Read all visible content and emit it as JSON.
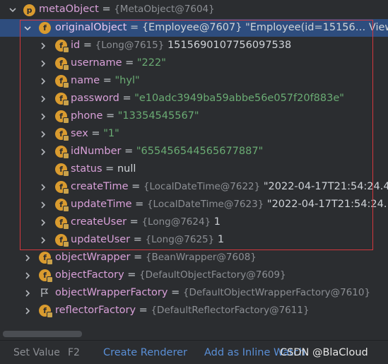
{
  "rows": [
    {
      "name": "metaObject",
      "badge": "p",
      "value": "{MetaObject@7604}",
      "value_kind": "gray",
      "extra": ""
    },
    {
      "name": "originalObject",
      "badge": "f",
      "value": "{Employee@7607}",
      "value_kind": "white",
      "extra": "\"Employee(id=15156… View"
    },
    {
      "name": "id",
      "badge": "f",
      "value": "{Long@7615}",
      "value_kind": "gray",
      "extra": "1515690107756097538"
    },
    {
      "name": "username",
      "badge": "f",
      "value": "\"222\"",
      "value_kind": "str",
      "extra": ""
    },
    {
      "name": "name",
      "badge": "f",
      "value": "\"hyl\"",
      "value_kind": "str",
      "extra": ""
    },
    {
      "name": "password",
      "badge": "f",
      "value": "\"e10adc3949ba59abbe56e057f20f883e\"",
      "value_kind": "str",
      "extra": ""
    },
    {
      "name": "phone",
      "badge": "f",
      "value": "\"13354545567\"",
      "value_kind": "str",
      "extra": ""
    },
    {
      "name": "sex",
      "badge": "f",
      "value": "\"1\"",
      "value_kind": "str",
      "extra": ""
    },
    {
      "name": "idNumber",
      "badge": "f",
      "value": "\"655456544565677887\"",
      "value_kind": "str",
      "extra": ""
    },
    {
      "name": "status",
      "badge": "f",
      "value": "null",
      "value_kind": "val",
      "extra": ""
    },
    {
      "name": "createTime",
      "badge": "f",
      "value": "{LocalDateTime@7622}",
      "value_kind": "gray",
      "extra": "\"2022-04-17T21:54:24.4"
    },
    {
      "name": "updateTime",
      "badge": "f",
      "value": "{LocalDateTime@7623}",
      "value_kind": "gray",
      "extra": "\"2022-04-17T21:54:24."
    },
    {
      "name": "createUser",
      "badge": "f",
      "value": "{Long@7624}",
      "value_kind": "gray",
      "extra": "1"
    },
    {
      "name": "updateUser",
      "badge": "f",
      "value": "{Long@7625}",
      "value_kind": "gray",
      "extra": "1"
    },
    {
      "name": "objectWrapper",
      "badge": "f",
      "value": "{BeanWrapper@7608}",
      "value_kind": "gray",
      "extra": ""
    },
    {
      "name": "objectFactory",
      "badge": "f",
      "value": "{DefaultObjectFactory@7609}",
      "value_kind": "gray",
      "extra": ""
    },
    {
      "name": "objectWrapperFactory",
      "badge": "flag",
      "value": "{DefaultObjectWrapperFactory@7610}",
      "value_kind": "gray",
      "extra": ""
    },
    {
      "name": "reflectorFactory",
      "badge": "f",
      "value": "{DefaultReflectorFactory@7611}",
      "value_kind": "gray",
      "extra": ""
    }
  ],
  "footer": {
    "set_value": "Set Value",
    "set_value_key": "F2",
    "create_renderer": "Create Renderer",
    "add_inline_watch": "Add as Inline Watch",
    "watermark": "CSDN @BlaCloud"
  },
  "colors": {
    "accent": "#2e4d7e",
    "highlight_border": "#d4373d",
    "string": "#6aab73",
    "link": "#5a8fd6"
  }
}
